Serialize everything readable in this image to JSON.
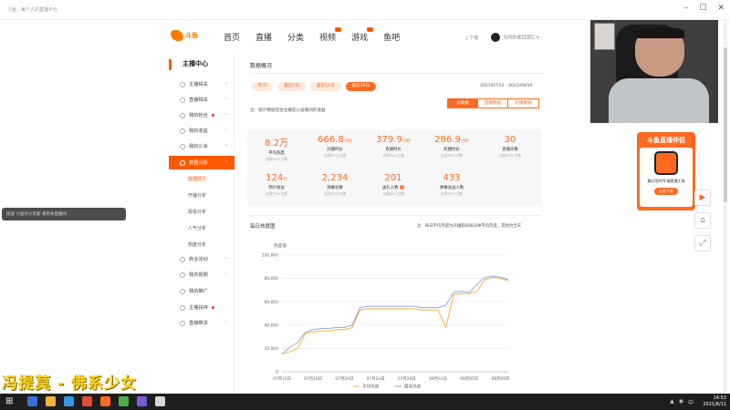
{
  "window": {
    "title": "斗鱼 - 每个人的直播平台"
  },
  "header": {
    "logo_text": "斗鱼",
    "logo_sub": "DOUYU.COM",
    "nav": [
      "首页",
      "直播",
      "分类",
      "视频",
      "游戏",
      "鱼吧"
    ],
    "download": "下载",
    "user": "无问的夏目回忆"
  },
  "sidebar": {
    "title": "主播中心",
    "items": [
      {
        "label": "主播相关"
      },
      {
        "label": "直播相关"
      },
      {
        "label": "我的粉丝"
      },
      {
        "label": "我的收益"
      },
      {
        "label": "我的公会"
      },
      {
        "label": "数据分析"
      }
    ],
    "sub_items": [
      "数据概况",
      "开播分析",
      "观看分析",
      "人气分析",
      "热度分析"
    ],
    "more_items": [
      "商业活动",
      "我的视频",
      "我的推广",
      "主播扶持",
      "直播带货"
    ]
  },
  "main": {
    "title": "数据概况",
    "periods": [
      "昨日",
      "最近7日",
      "最近14日",
      "最近30日"
    ],
    "date_range": "2021/07/12 - 2021/08/10",
    "segments": [
      "总数据",
      "直播数据",
      "轮播数据"
    ],
    "note": "注：统计数据包含主播在公会期间的收益",
    "stats": [
      {
        "value": "8.2万",
        "unit": "",
        "label": "平均热度",
        "sub": "击败93%主播"
      },
      {
        "value": "666.8",
        "unit": "小时",
        "label": "开播时长",
        "sub": "击败99%主播"
      },
      {
        "value": "379.9",
        "unit": "小时",
        "label": "直播时长",
        "sub": "击败98%主播"
      },
      {
        "value": "286.9",
        "unit": "小时",
        "label": "轮播时长",
        "sub": "击败99%主播"
      },
      {
        "value": "30",
        "unit": "",
        "label": "直播天数",
        "sub": "击败97%主播"
      },
      {
        "value": "124",
        "unit": "元",
        "label": "预计收益",
        "sub": "击败79%主播"
      },
      {
        "value": "2,234",
        "unit": "",
        "label": "弹幕总数",
        "sub": "击败93%主播"
      },
      {
        "value": "201",
        "unit": "",
        "label": "送礼人数",
        "sub": "击败85%主播"
      },
      {
        "value": "433",
        "unit": "",
        "label": "弹幕发送人数",
        "sub": "击败93%主播"
      }
    ],
    "chart_title": "每日热度图",
    "chart_note": "注：每日平均热度为开播期间每分钟平均热度，其他为全天"
  },
  "chart_data": {
    "type": "line",
    "ylabel": "热度值",
    "ylim": [
      0,
      100000
    ],
    "yticks": [
      "0",
      "20,000",
      "40,000",
      "60,000",
      "80,000",
      "100,000"
    ],
    "xticks": [
      "07月12日",
      "07月16日",
      "07月20日",
      "07月24日",
      "07月28日",
      "08月01日",
      "08月05日",
      "08月09日"
    ],
    "x": [
      0,
      1,
      2,
      3,
      4,
      5,
      6,
      7,
      8,
      9,
      10,
      11,
      12,
      13,
      14,
      15,
      16,
      17,
      18,
      19,
      20,
      21,
      22,
      23,
      24,
      25,
      26,
      27,
      28,
      29
    ],
    "series": [
      {
        "name": "平均热度",
        "color": "#f5b342",
        "values": [
          15000,
          17000,
          20000,
          33000,
          34000,
          35000,
          35000,
          36000,
          36000,
          38000,
          53000,
          54000,
          54000,
          54000,
          54000,
          54000,
          54000,
          54000,
          53000,
          53000,
          53000,
          38000,
          66000,
          67000,
          67000,
          69000,
          79000,
          81000,
          80000,
          78000
        ]
      },
      {
        "name": "最高热度",
        "color": "#9aa8d8",
        "values": [
          15000,
          21000,
          25000,
          34000,
          36000,
          37000,
          37000,
          38000,
          38000,
          40000,
          55000,
          56000,
          56000,
          56000,
          56000,
          56000,
          56000,
          56000,
          55000,
          55000,
          55000,
          57000,
          68000,
          69000,
          68000,
          75000,
          81000,
          82000,
          81000,
          79000
        ]
      }
    ]
  },
  "promo": {
    "title": "斗鱼直播伴侣",
    "text": "最好用的PC端直播工具",
    "button": "立即下载",
    "logo_text": "DOUYU"
  },
  "notice": "欢迎 小鱼仔小可爱 来到本直播间",
  "overlay_text": "冯提莫 - 佛系少女",
  "taskbar": {
    "time": "14:53",
    "date": "2021/8/11"
  },
  "accent_color": "#ff6a21"
}
